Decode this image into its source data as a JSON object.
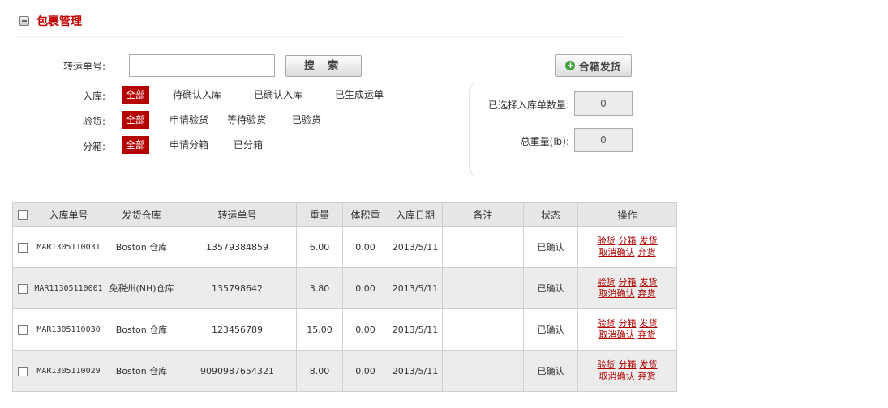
{
  "page_title": "包裹管理",
  "search": {
    "label": "转运单号:",
    "value": "",
    "button": "搜 索"
  },
  "filters": {
    "storage": {
      "label": "入库:",
      "options": [
        "全部",
        "待确认入库",
        "已确认入库",
        "已生成运单"
      ]
    },
    "inspect": {
      "label": "验货:",
      "options": [
        "全部",
        "申请验货",
        "等待验货",
        "已验货"
      ]
    },
    "split": {
      "label": "分箱:",
      "options": [
        "全部",
        "申请分箱",
        "已分箱"
      ]
    }
  },
  "combine_button": "合箱发货",
  "stats": {
    "selected_label": "已选择入库单数量:",
    "selected_value": "0",
    "weight_label": "总重量(lb):",
    "weight_value": "0"
  },
  "table": {
    "headers": [
      "入库单号",
      "发货仓库",
      "转运单号",
      "重量",
      "体积重",
      "入库日期",
      "备注",
      "状态",
      "操作"
    ],
    "rows": [
      {
        "id": "MAR1305110031",
        "warehouse": "Boston 仓库",
        "tracking": "13579384859",
        "weight": "6.00",
        "vol": "0.00",
        "date": "2013/5/11",
        "note": "",
        "status": "已确认"
      },
      {
        "id": "MAR11305110001",
        "warehouse": "免税州(NH)仓库",
        "tracking": "135798642",
        "weight": "3.80",
        "vol": "0.00",
        "date": "2013/5/11",
        "note": "",
        "status": "已确认"
      },
      {
        "id": "MAR1305110030",
        "warehouse": "Boston 仓库",
        "tracking": "123456789",
        "weight": "15.00",
        "vol": "0.00",
        "date": "2013/5/11",
        "note": "",
        "status": "已确认"
      },
      {
        "id": "MAR1305110029",
        "warehouse": "Boston 仓库",
        "tracking": "9090987654321",
        "weight": "8.00",
        "vol": "0.00",
        "date": "2013/5/11",
        "note": "",
        "status": "已确认"
      }
    ],
    "actions": {
      "inspect": "验货",
      "split": "分箱",
      "ship": "发货",
      "cancel": "取消确认",
      "discard": "弃货"
    }
  },
  "colors": {
    "accent": "#b50000",
    "title": "#c00000",
    "link": "#b00000"
  },
  "icons": {
    "title": "collapse-icon",
    "combine": "plus-circle-icon"
  }
}
